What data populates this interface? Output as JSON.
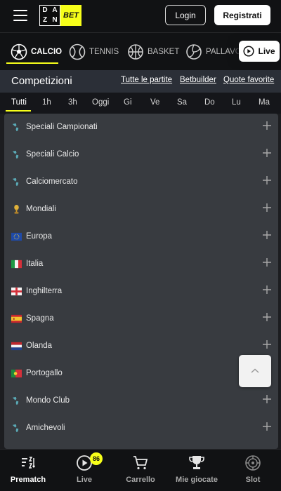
{
  "header": {
    "logo_top_left": "D",
    "logo_top_right": "A",
    "logo_bottom_left": "Z",
    "logo_bottom_right": "N",
    "logo_bet": "BET",
    "login_label": "Login",
    "register_label": "Registrati"
  },
  "sports": {
    "items": [
      {
        "label": "CALCIO",
        "icon": "soccer-ball-icon",
        "active": true
      },
      {
        "label": "TENNIS",
        "icon": "tennis-ball-icon",
        "active": false
      },
      {
        "label": "BASKET",
        "icon": "basketball-icon",
        "active": false
      },
      {
        "label": "PALLAVOLO",
        "icon": "volleyball-icon",
        "active": false
      }
    ],
    "live_label": "Live"
  },
  "competizioni": {
    "title": "Competizioni",
    "links": [
      "Tutte le partite",
      "Betbuilder",
      "Quote favorite"
    ]
  },
  "time_filters": {
    "items": [
      "Tutti",
      "1h",
      "3h",
      "Oggi",
      "Gi",
      "Ve",
      "Sa",
      "Do",
      "Lu",
      "Ma"
    ],
    "active": "Tutti"
  },
  "competitions": [
    {
      "label": "Speciali Campionati",
      "icon": "globe-icon"
    },
    {
      "label": "Speciali Calcio",
      "icon": "globe-icon"
    },
    {
      "label": "Calciomercato",
      "icon": "globe-icon"
    },
    {
      "label": "Mondiali",
      "icon": "trophy-icon"
    },
    {
      "label": "Europa",
      "icon": "eu-flag-icon"
    },
    {
      "label": "Italia",
      "icon": "italy-flag-icon"
    },
    {
      "label": "Inghilterra",
      "icon": "england-flag-icon"
    },
    {
      "label": "Spagna",
      "icon": "spain-flag-icon"
    },
    {
      "label": "Olanda",
      "icon": "netherlands-flag-icon"
    },
    {
      "label": "Portogallo",
      "icon": "portugal-flag-icon"
    },
    {
      "label": "Mondo Club",
      "icon": "globe-icon"
    },
    {
      "label": "Amichevoli",
      "icon": "globe-icon"
    }
  ],
  "bottom_nav": {
    "items": [
      {
        "label": "Prematch",
        "icon": "sort-az-icon",
        "active": true
      },
      {
        "label": "Live",
        "icon": "play-circle-icon",
        "active": false,
        "badge": "86"
      },
      {
        "label": "Carrello",
        "icon": "cart-icon",
        "active": false
      },
      {
        "label": "Mie giocate",
        "icon": "trophy-icon",
        "active": false
      },
      {
        "label": "Slot",
        "icon": "slot-reel-icon",
        "active": false
      }
    ]
  },
  "colors": {
    "accent": "#f7ff1a",
    "background": "#1c1d20",
    "list_background": "#383b40",
    "header_background": "#111214"
  }
}
